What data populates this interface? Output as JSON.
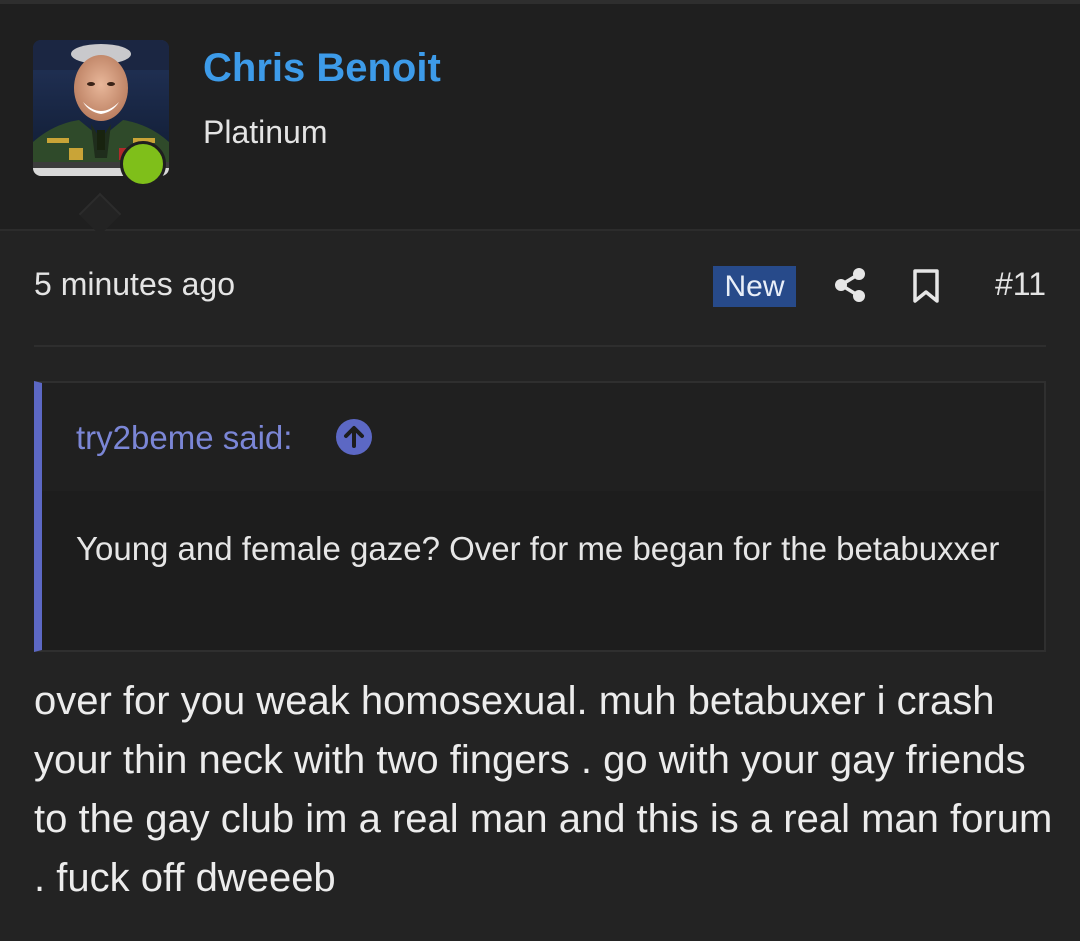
{
  "user": {
    "name": "Chris Benoit",
    "title": "Platinum",
    "avatar_alt": "user avatar",
    "online_color": "#7fbf1a"
  },
  "post": {
    "time": "5 minutes ago",
    "badge": "New",
    "number": "#11",
    "share_icon": "share-icon",
    "bookmark_icon": "bookmark-icon",
    "body": "over for you weak homosexual. muh betabuxer i crash your thin neck with two fingers . go with your gay friends to the gay club im a real man and this is a real man forum . fuck off dweeeb"
  },
  "quote": {
    "author": "try2beme said:",
    "jump_icon": "arrow-up-circle-icon",
    "text": "Young and female gaze? Over for me began for the betabuxxer"
  },
  "colors": {
    "background": "#232323",
    "username": "#3d9be9",
    "badge_bg": "#274a8a",
    "quote_accent": "#5c68c4"
  }
}
